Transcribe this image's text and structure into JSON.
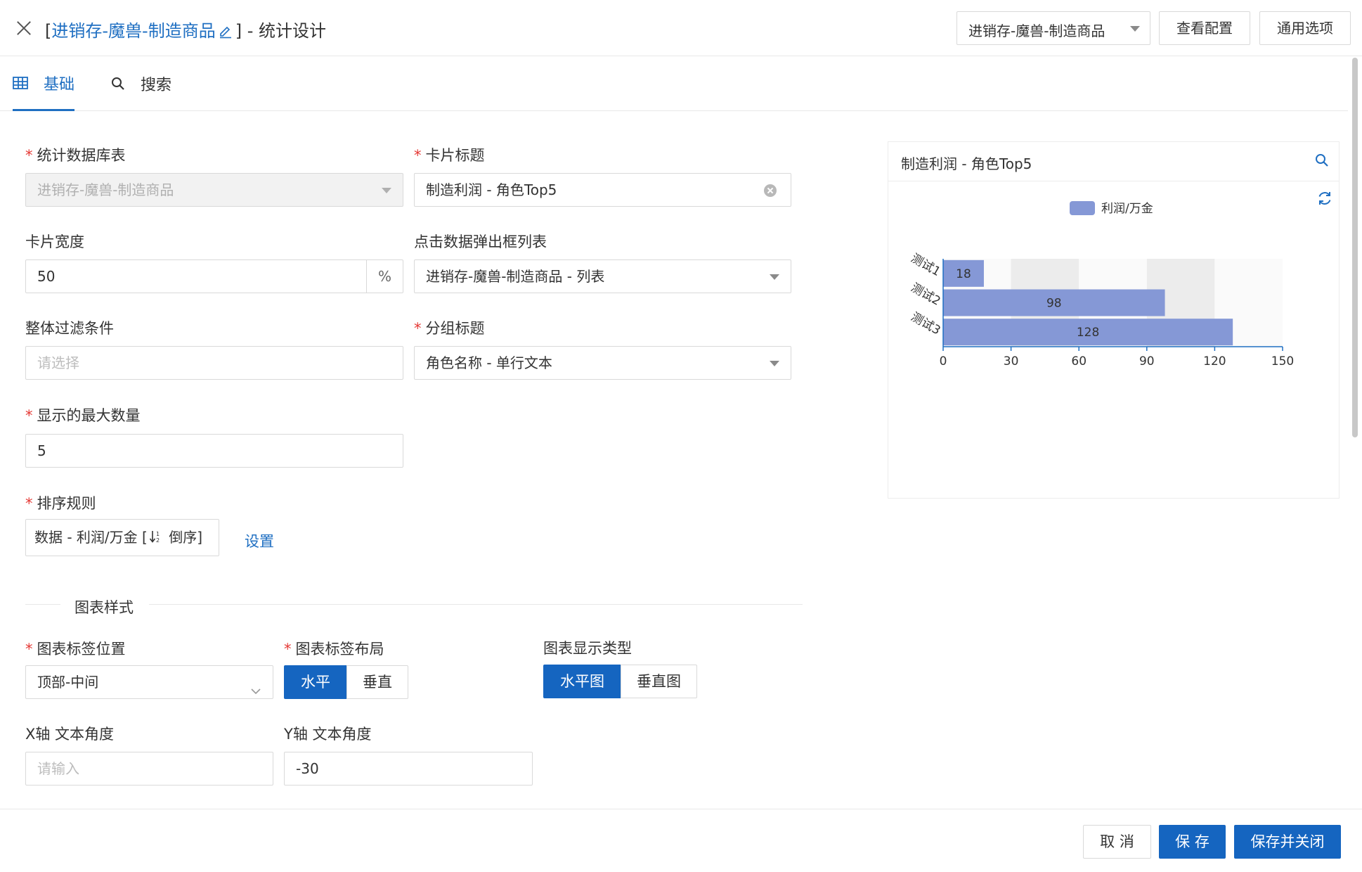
{
  "header": {
    "title_prefix": "[",
    "title_link": "进销存-魔兽-制造商品",
    "title_suffix": "] - 统计设计",
    "table_select": "进销存-魔兽-制造商品",
    "view_config_btn": "查看配置",
    "common_options_btn": "通用选项"
  },
  "tabs": [
    {
      "label": "基础",
      "icon": "table-icon",
      "active": true
    },
    {
      "label": "搜索",
      "icon": "search-icon",
      "active": false
    }
  ],
  "form": {
    "stat_table": {
      "label": "统计数据库表",
      "value": "进销存-魔兽-制造商品",
      "required": true
    },
    "card_title": {
      "label": "卡片标题",
      "value": "制造利润 - 角色Top5",
      "required": true
    },
    "card_width": {
      "label": "卡片宽度",
      "value": "50",
      "suffix": "%"
    },
    "click_popup": {
      "label": "点击数据弹出框列表",
      "value": "进销存-魔兽-制造商品 - 列表"
    },
    "filter": {
      "label": "整体过滤条件",
      "placeholder": "请选择"
    },
    "group_title": {
      "label": "分组标题",
      "value": "角色名称 - 单行文本",
      "required": true
    },
    "max_count": {
      "label": "显示的最大数量",
      "value": "5",
      "required": true
    },
    "sort_rule": {
      "label": "排序规则",
      "value_prefix": "数据 - 利润/万金 [",
      "value_suffix": " 倒序]",
      "setting_link": "设置",
      "required": true
    },
    "chart_style_section": "图表样式",
    "label_position": {
      "label": "图表标签位置",
      "value": "顶部-中间",
      "required": true
    },
    "label_layout": {
      "label": "图表标签布局",
      "options": [
        "水平",
        "垂直"
      ],
      "selected": "水平",
      "required": true
    },
    "display_type": {
      "label": "图表显示类型",
      "options": [
        "水平图",
        "垂直图"
      ],
      "selected": "水平图"
    },
    "x_angle": {
      "label": "X轴 文本角度",
      "placeholder": "请输入"
    },
    "y_angle": {
      "label": "Y轴 文本角度",
      "value": "-30"
    }
  },
  "card": {
    "title": "制造利润 - 角色Top5"
  },
  "chart_data": {
    "type": "bar",
    "orientation": "horizontal",
    "categories": [
      "测试1",
      "测试2",
      "测试3"
    ],
    "series": [
      {
        "name": "利润/万金",
        "values": [
          18,
          98,
          128
        ],
        "color": "#8598d6"
      }
    ],
    "xlim": [
      0,
      150
    ],
    "xticks": [
      "0",
      "30",
      "60",
      "90",
      "120",
      "150"
    ],
    "legend": "top-center",
    "data_labels": true
  },
  "footer": {
    "cancel": "取 消",
    "save": "保 存",
    "save_close": "保存并关闭"
  },
  "colors": {
    "primary": "#1565c0",
    "link": "#1f6fc2",
    "required": "#e53935"
  }
}
